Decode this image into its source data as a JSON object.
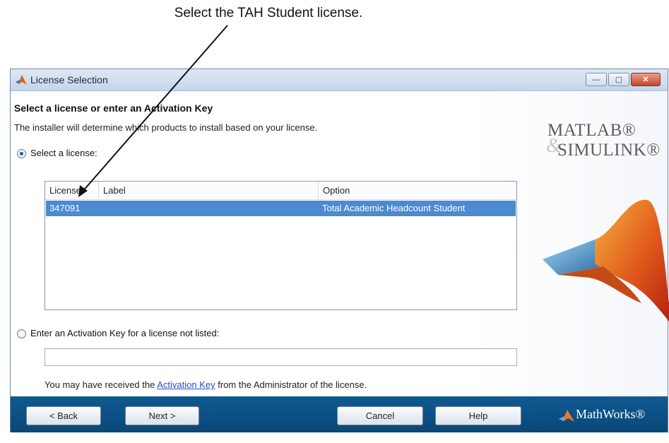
{
  "annotation": {
    "text": "Select the TAH Student license."
  },
  "window": {
    "title": "License Selection",
    "controls": {
      "minimize": "—",
      "maximize": "▢",
      "close": "✕"
    }
  },
  "content": {
    "heading": "Select a license or enter an Activation Key",
    "description": "The installer will determine which products to install based on your license.",
    "select_license": {
      "label": "Select a license:",
      "checked": true
    },
    "license_table": {
      "columns": [
        "License",
        "Label",
        "Option"
      ],
      "rows": [
        {
          "license": "347091",
          "label": "",
          "option": "Total Academic Headcount Student",
          "selected": true
        }
      ]
    },
    "activation_key": {
      "label": "Enter an Activation Key for a license not listed:",
      "checked": false,
      "value": ""
    },
    "admin_note": {
      "before": "You may have received the ",
      "link": "Activation Key",
      "after": " from the Administrator of the license."
    }
  },
  "branding": {
    "matlab": "MATLAB®",
    "ampersand": "&",
    "simulink": "SIMULINK®",
    "mathworks": "MathWorks®"
  },
  "footer": {
    "back": "< Back",
    "next": "Next >",
    "cancel": "Cancel",
    "help": "Help"
  },
  "colors": {
    "selection": "#4c8ad1",
    "footer": "#0c4f83",
    "link": "#1f4fd1"
  }
}
